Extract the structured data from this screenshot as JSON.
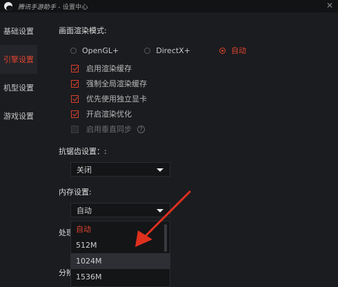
{
  "window": {
    "app_name": "腾讯手游助手",
    "separator": "-",
    "title": "设置中心"
  },
  "sidebar": {
    "items": [
      {
        "label": "基础设置",
        "active": false
      },
      {
        "label": "引擎设置",
        "active": true
      },
      {
        "label": "机型设置",
        "active": false
      },
      {
        "label": "游戏设置",
        "active": false
      }
    ]
  },
  "render_mode": {
    "label": "画面渲染模式:",
    "options": [
      {
        "label": "OpenGL+",
        "selected": false
      },
      {
        "label": "DirectX+",
        "selected": false
      },
      {
        "label": "自动",
        "selected": true
      }
    ]
  },
  "render_options": [
    {
      "label": "启用渲染缓存",
      "checked": true,
      "disabled": false
    },
    {
      "label": "强制全局渲染缓存",
      "checked": true,
      "disabled": false
    },
    {
      "label": "优先使用独立显卡",
      "checked": true,
      "disabled": false
    },
    {
      "label": "开启渲染优化",
      "checked": true,
      "disabled": false
    },
    {
      "label": "启用垂直同步",
      "checked": false,
      "disabled": true
    }
  ],
  "antialias": {
    "label": "抗锯齿设置：:",
    "value": "关闭"
  },
  "memory": {
    "label": "内存设置:",
    "value": "自动",
    "options": [
      "自动",
      "512M",
      "1024M",
      "1536M"
    ],
    "current_option": "自动",
    "hover_option": "1024M"
  },
  "processor": {
    "label_partial": "处理"
  },
  "resolution": {
    "label_partial": "分辨"
  },
  "colors": {
    "accent": "#e0442f",
    "background": "#1b1c1f",
    "arrow": "#e0301e"
  },
  "icons": {
    "logo": "app-logo-icon",
    "close": "close-icon",
    "help": "help-circle-icon",
    "dropdown": "caret-down-icon"
  }
}
